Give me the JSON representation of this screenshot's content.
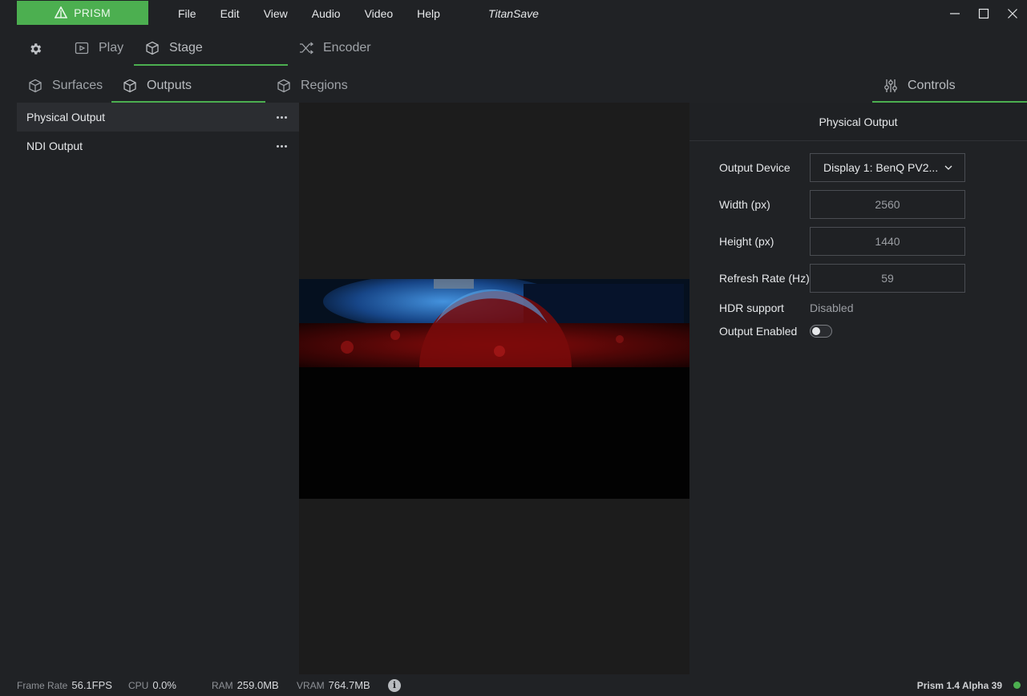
{
  "app": {
    "brand": "PRISM",
    "title": "TitanSave",
    "accent_color": "#4caf50"
  },
  "menu": [
    "File",
    "Edit",
    "View",
    "Audio",
    "Video",
    "Help"
  ],
  "top_tabs": {
    "settings_icon": "gear-icon",
    "play": "Play",
    "stage": "Stage",
    "encoder": "Encoder",
    "active": "Stage"
  },
  "sub_tabs": {
    "surfaces": "Surfaces",
    "outputs": "Outputs",
    "regions": "Regions",
    "controls": "Controls",
    "active": "Outputs"
  },
  "outputs": [
    {
      "label": "Physical Output",
      "selected": true
    },
    {
      "label": "NDI Output",
      "selected": false
    }
  ],
  "controls": {
    "header": "Physical Output",
    "output_device_label": "Output Device",
    "output_device_value": "Display 1: BenQ PV2...",
    "width_label": "Width (px)",
    "width_value": "2560",
    "height_label": "Height (px)",
    "height_value": "1440",
    "refresh_label": "Refresh Rate (Hz)",
    "refresh_value": "59",
    "hdr_label": "HDR support",
    "hdr_value": "Disabled",
    "enabled_label": "Output Enabled",
    "enabled": false
  },
  "status": {
    "frame_rate_label": "Frame Rate",
    "frame_rate_value": "56.1FPS",
    "cpu_label": "CPU",
    "cpu_value": "0.0%",
    "ram_label": "RAM",
    "ram_value": "259.0MB",
    "vram_label": "VRAM",
    "vram_value": "764.7MB",
    "info_glyph": "i",
    "version": "Prism 1.4 Alpha 39",
    "status_color": "#4caf50"
  }
}
